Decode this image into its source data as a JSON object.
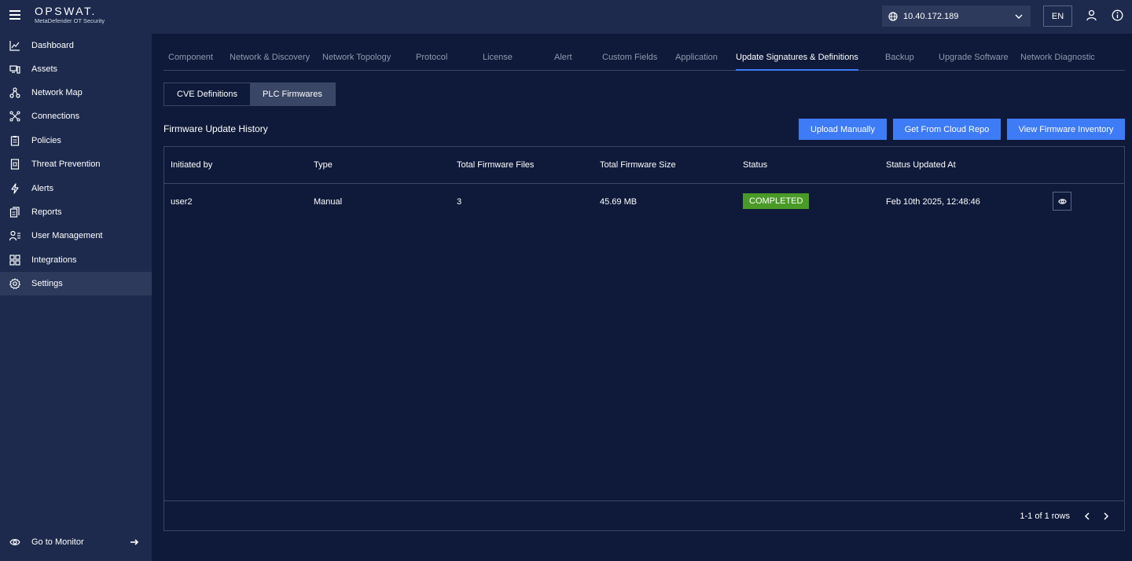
{
  "header": {
    "logo_main": "OPSWAT.",
    "logo_sub": "MetaDefender OT Security",
    "ip_address": "10.40.172.189",
    "language": "EN"
  },
  "sidebar": {
    "items": [
      {
        "label": "Dashboard"
      },
      {
        "label": "Assets"
      },
      {
        "label": "Network Map"
      },
      {
        "label": "Connections"
      },
      {
        "label": "Policies"
      },
      {
        "label": "Threat Prevention"
      },
      {
        "label": "Alerts"
      },
      {
        "label": "Reports"
      },
      {
        "label": "User Management"
      },
      {
        "label": "Integrations"
      },
      {
        "label": "Settings"
      }
    ],
    "active": "Settings",
    "bottom_label": "Go to Monitor"
  },
  "tabs": [
    {
      "label": "Component"
    },
    {
      "label": "Network & Discovery"
    },
    {
      "label": "Network Topology"
    },
    {
      "label": "Protocol"
    },
    {
      "label": "License"
    },
    {
      "label": "Alert"
    },
    {
      "label": "Custom Fields"
    },
    {
      "label": "Application"
    },
    {
      "label": "Update Signatures & Definitions"
    },
    {
      "label": "Backup"
    },
    {
      "label": "Upgrade Software"
    },
    {
      "label": "Network Diagnostic"
    }
  ],
  "active_tab": "Update Signatures & Definitions",
  "subtabs": [
    {
      "label": "CVE Definitions"
    },
    {
      "label": "PLC Firmwares"
    }
  ],
  "active_subtab": "PLC Firmwares",
  "section_title": "Firmware Update History",
  "actions": {
    "upload": "Upload Manually",
    "cloud": "Get From Cloud Repo",
    "inventory": "View Firmware Inventory"
  },
  "table": {
    "columns": [
      "Initiated by",
      "Type",
      "Total Firmware Files",
      "Total Firmware Size",
      "Status",
      "Status Updated At"
    ],
    "rows": [
      {
        "initiated_by": "user2",
        "type": "Manual",
        "files": "3",
        "size": "45.69 MB",
        "status": "COMPLETED",
        "updated_at": "Feb 10th 2025, 12:48:46"
      }
    ],
    "pagination": "1-1 of 1 rows"
  },
  "colors": {
    "background": "#0f1a3a",
    "panel": "#1d2a4d",
    "accent": "#3e7bf6",
    "status_completed": "#4a9a27"
  }
}
